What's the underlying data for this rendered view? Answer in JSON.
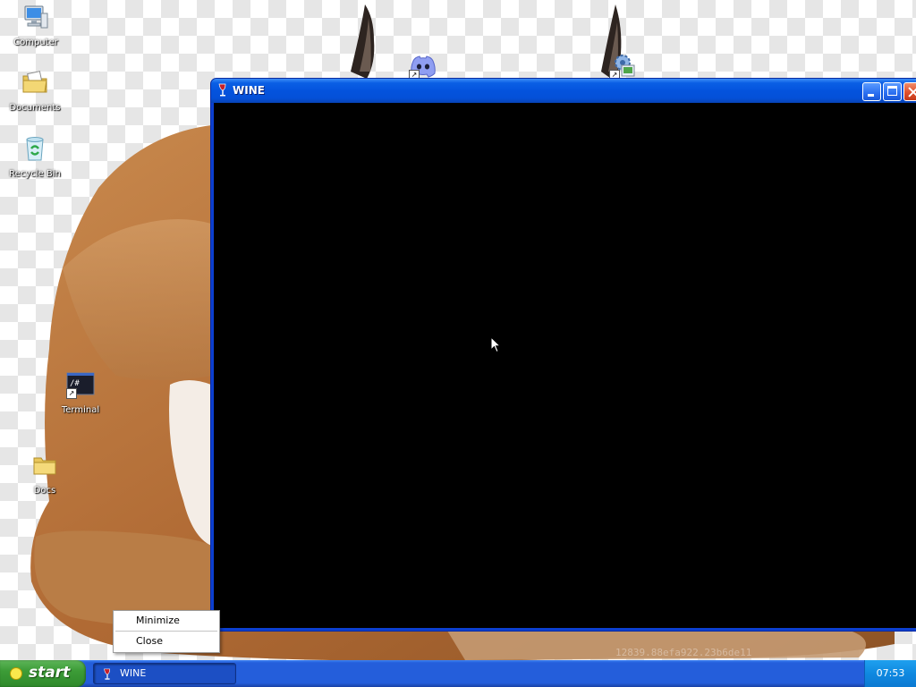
{
  "desktop": {
    "icons": [
      {
        "label": "Computer",
        "icon": "computer-icon"
      },
      {
        "label": "Documents",
        "icon": "documents-folder-icon"
      },
      {
        "label": "Recycle Bin",
        "icon": "recycle-bin-icon"
      },
      {
        "label": "Terminal",
        "icon": "terminal-icon"
      },
      {
        "label": "Docs",
        "icon": "folder-icon"
      }
    ],
    "unlabeled_icons": [
      "discord-shortcut-icon",
      "settings-shortcut-icon"
    ]
  },
  "window": {
    "title": "WINE",
    "icon": "wine-glass-icon",
    "client_background": "#000000"
  },
  "context_menu": {
    "items": [
      "Minimize",
      "Close"
    ]
  },
  "taskbar": {
    "start_label": "start",
    "tasks": [
      {
        "label": "WINE",
        "icon": "wine-glass-icon"
      }
    ],
    "clock": "07:53"
  },
  "colors": {
    "taskbar_blue": "#245edb",
    "start_green": "#3c9c37",
    "title_bar_blue": "#0453dd",
    "close_red": "#e0502c"
  }
}
